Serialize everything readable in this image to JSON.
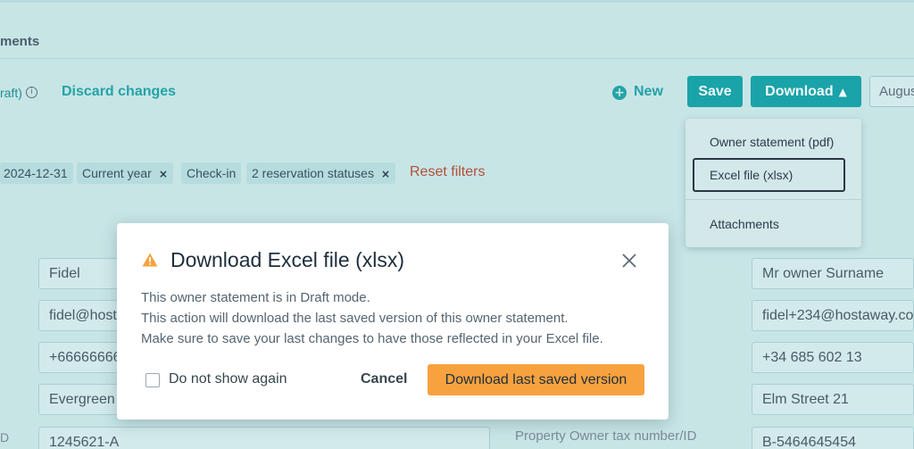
{
  "header": {
    "tab_title": "ments"
  },
  "toolbar": {
    "draft_label": "raft)",
    "discard_label": "Discard changes",
    "new_label": "New",
    "save_label": "Save",
    "download_label": "Download",
    "month_value": "Augus"
  },
  "download_menu": {
    "items": [
      "Owner statement (pdf)",
      "Excel file (xlsx)",
      "Attachments"
    ]
  },
  "filters": {
    "chips": [
      "2024-12-31",
      "Current year",
      "Check-in",
      "2 reservation statuses"
    ],
    "reset_label": "Reset filters"
  },
  "form": {
    "left_fields": [
      "Fidel",
      "fidel@host",
      "+666666666",
      "Evergreen",
      "1245621-A"
    ],
    "right_fields": [
      "Mr owner Surname",
      "fidel+234@hostaway.co",
      "+34 685 602 13",
      "Elm Street 21",
      "B-5464645454"
    ],
    "tax_label": "Property Owner tax number/ID",
    "left_cut_label": "D"
  },
  "modal": {
    "title": "Download Excel file (xlsx)",
    "lines": [
      "This owner statement is in Draft mode.",
      "This action will download the last saved version of this owner statement.",
      "Make sure to save your last changes to have those reflected in your Excel file."
    ],
    "checkbox_label": "Do not show again",
    "cancel_label": "Cancel",
    "primary_label": "Download last saved version"
  },
  "colors": {
    "accent": "#1aa3a8",
    "warning": "#f7a23e",
    "reset": "#b24f3b"
  }
}
